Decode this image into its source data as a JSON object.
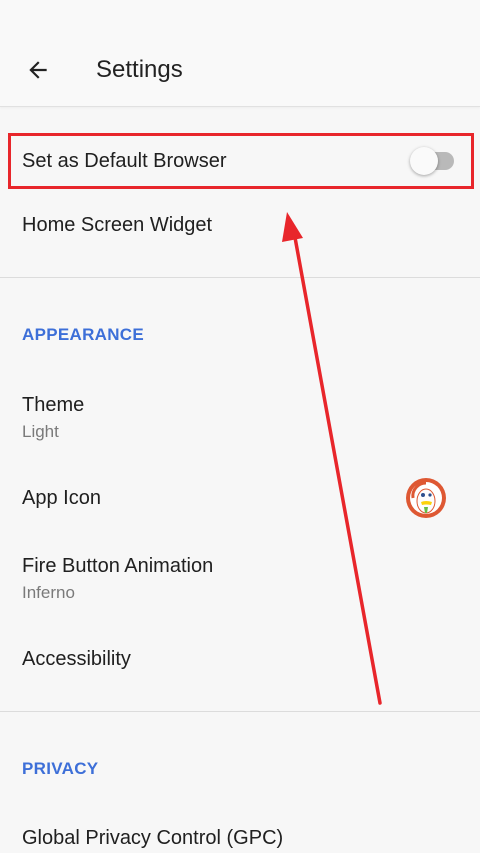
{
  "header": {
    "title": "Settings",
    "back_icon": "arrow-left-icon"
  },
  "general": {
    "default_browser": {
      "label": "Set as Default Browser",
      "toggle_on": false
    },
    "widget": {
      "label": "Home Screen Widget"
    }
  },
  "appearance": {
    "header": "APPEARANCE",
    "theme": {
      "label": "Theme",
      "value": "Light"
    },
    "app_icon": {
      "label": "App Icon",
      "icon": "duckduckgo-logo-icon"
    },
    "fire_animation": {
      "label": "Fire Button Animation",
      "value": "Inferno"
    },
    "accessibility": {
      "label": "Accessibility"
    }
  },
  "privacy": {
    "header": "PRIVACY",
    "gpc": {
      "label": "Global Privacy Control (GPC)"
    }
  },
  "colors": {
    "accent": "#3d6fd8",
    "annotation_red": "#e8262b",
    "background": "#f7f7f7"
  }
}
